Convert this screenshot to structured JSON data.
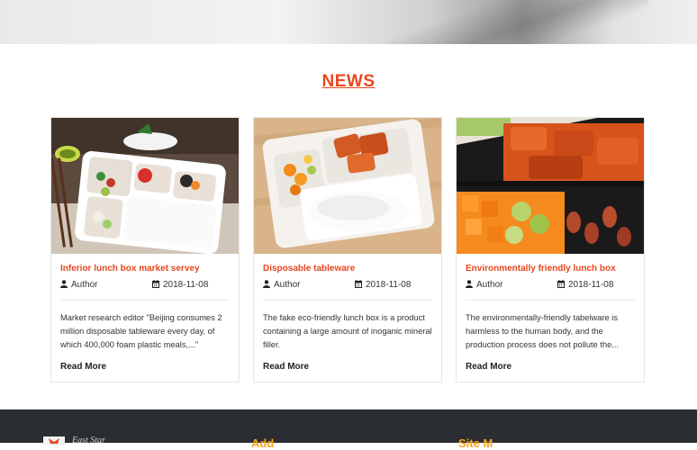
{
  "section_title": "NEWS",
  "articles": [
    {
      "title": "Inferior lunch box market servey",
      "author": "Author",
      "date": "2018-11-08",
      "excerpt": "Market research editor \"Beijing consumes 2 million disposable tableware every day, of which 400,000 foam plastic meals,...\"",
      "read_more": "Read More"
    },
    {
      "title": "Disposable tableware",
      "author": "Author",
      "date": "2018-11-08",
      "excerpt": "The fake eco-friendly lunch box is a product containing a large amount of inoganic mineral filler.",
      "read_more": "Read More"
    },
    {
      "title": "Environmentally friendly lunch box",
      "author": "Author",
      "date": "2018-11-08",
      "excerpt": "The environmentally-friendly tabelware is harmless to the human body, and the production process does not pollute the...",
      "read_more": "Read More"
    }
  ],
  "footer": {
    "brand": "East Star",
    "address_heading": "Add",
    "sitemap_heading": "Site M"
  },
  "colors": {
    "accent": "#e8461d",
    "footer_bg": "#2a2d31",
    "footer_heading": "#f5a31a"
  }
}
